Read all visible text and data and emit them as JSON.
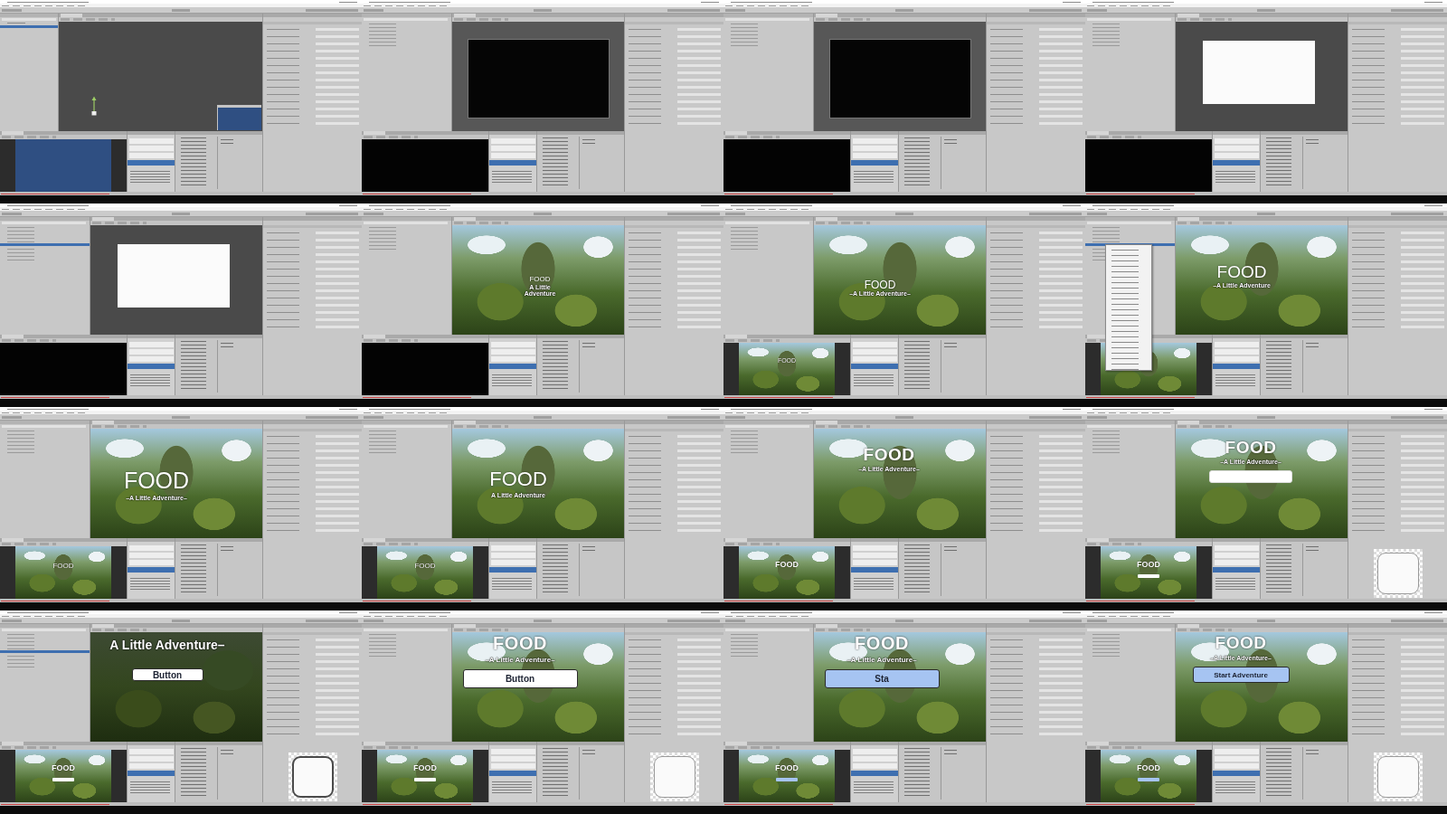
{
  "thumbnails": [
    {
      "scene": {
        "kind": "empty"
      },
      "game_view": {
        "kind": "blue"
      },
      "context_menu": false,
      "sprite_preview": false
    },
    {
      "scene": {
        "kind": "black-canvas"
      },
      "game_view": {
        "kind": "black"
      },
      "context_menu": false,
      "sprite_preview": false
    },
    {
      "scene": {
        "kind": "black-canvas"
      },
      "game_view": {
        "kind": "black"
      },
      "context_menu": false,
      "sprite_preview": false
    },
    {
      "scene": {
        "kind": "white-canvas"
      },
      "game_view": {
        "kind": "black"
      },
      "context_menu": false,
      "sprite_preview": false
    },
    {
      "scene": {
        "kind": "white-canvas"
      },
      "game_view": {
        "kind": "black"
      },
      "context_menu": false,
      "sprite_preview": false
    },
    {
      "scene": {
        "kind": "jungle",
        "title": "FOOD",
        "subtitle": "A Little Adventure"
      },
      "game_view": {
        "kind": "black"
      },
      "context_menu": false,
      "sprite_preview": false
    },
    {
      "scene": {
        "kind": "jungle",
        "title": "FOOD",
        "subtitle": "–A Little Adventure–"
      },
      "game_view": {
        "kind": "jungle",
        "title": "FOOD"
      },
      "context_menu": false,
      "sprite_preview": false
    },
    {
      "scene": {
        "kind": "jungle",
        "title": "FOOD",
        "subtitle": "–A Little Adventure"
      },
      "game_view": {
        "kind": "jungle"
      },
      "context_menu": true,
      "sprite_preview": false
    },
    {
      "scene": {
        "kind": "jungle",
        "title": "FOOD",
        "subtitle": "–A Little Adventure–"
      },
      "game_view": {
        "kind": "jungle",
        "title": "FOOD"
      },
      "context_menu": false,
      "sprite_preview": false
    },
    {
      "scene": {
        "kind": "jungle",
        "title": "FOOD",
        "subtitle": "A Little Adventure"
      },
      "game_view": {
        "kind": "jungle",
        "title": "FOOD"
      },
      "context_menu": false,
      "sprite_preview": false
    },
    {
      "scene": {
        "kind": "jungle",
        "title": "FOOD",
        "subtitle": "–A Little Adventure–"
      },
      "game_view": {
        "kind": "jungle",
        "title": "FOOD"
      },
      "context_menu": false,
      "sprite_preview": false
    },
    {
      "scene": {
        "kind": "jungle",
        "title": "FOOD",
        "subtitle": "–A Little Adventure–",
        "button": {
          "color": "#ffffff"
        }
      },
      "game_view": {
        "kind": "jungle",
        "title": "FOOD",
        "button": {
          "color": "#ffffff"
        }
      },
      "context_menu": false,
      "sprite_preview": true
    },
    {
      "scene": {
        "kind": "jungle",
        "subtitle": "A Little Adventure–",
        "button": {
          "label": "Button",
          "color": "#ffffff"
        }
      },
      "game_view": {
        "kind": "jungle",
        "title": "FOOD",
        "button": {
          "color": "#ffffff"
        }
      },
      "context_menu": false,
      "sprite_preview": true
    },
    {
      "scene": {
        "kind": "jungle",
        "title": "FOOD",
        "subtitle": "–A Little Adventure–",
        "button": {
          "label": "Button",
          "color": "#ffffff"
        }
      },
      "game_view": {
        "kind": "jungle",
        "title": "FOOD",
        "button": {
          "color": "#ffffff"
        }
      },
      "context_menu": false,
      "sprite_preview": true
    },
    {
      "scene": {
        "kind": "jungle",
        "title": "FOOD",
        "subtitle": "–A Little Adventure–",
        "button": {
          "label": "Sta",
          "color": "#a6c4f2"
        }
      },
      "game_view": {
        "kind": "jungle",
        "title": "FOOD",
        "button": {
          "color": "#a6c4f2"
        }
      },
      "context_menu": false,
      "sprite_preview": false
    },
    {
      "scene": {
        "kind": "jungle",
        "title": "FOOD",
        "subtitle": "–A Little Adventure–",
        "button": {
          "label": "Start Adventure",
          "color": "#a6c4f2"
        }
      },
      "game_view": {
        "kind": "jungle",
        "title": "FOOD",
        "button": {
          "color": "#a6c4f2"
        }
      },
      "context_menu": false,
      "sprite_preview": true
    }
  ]
}
